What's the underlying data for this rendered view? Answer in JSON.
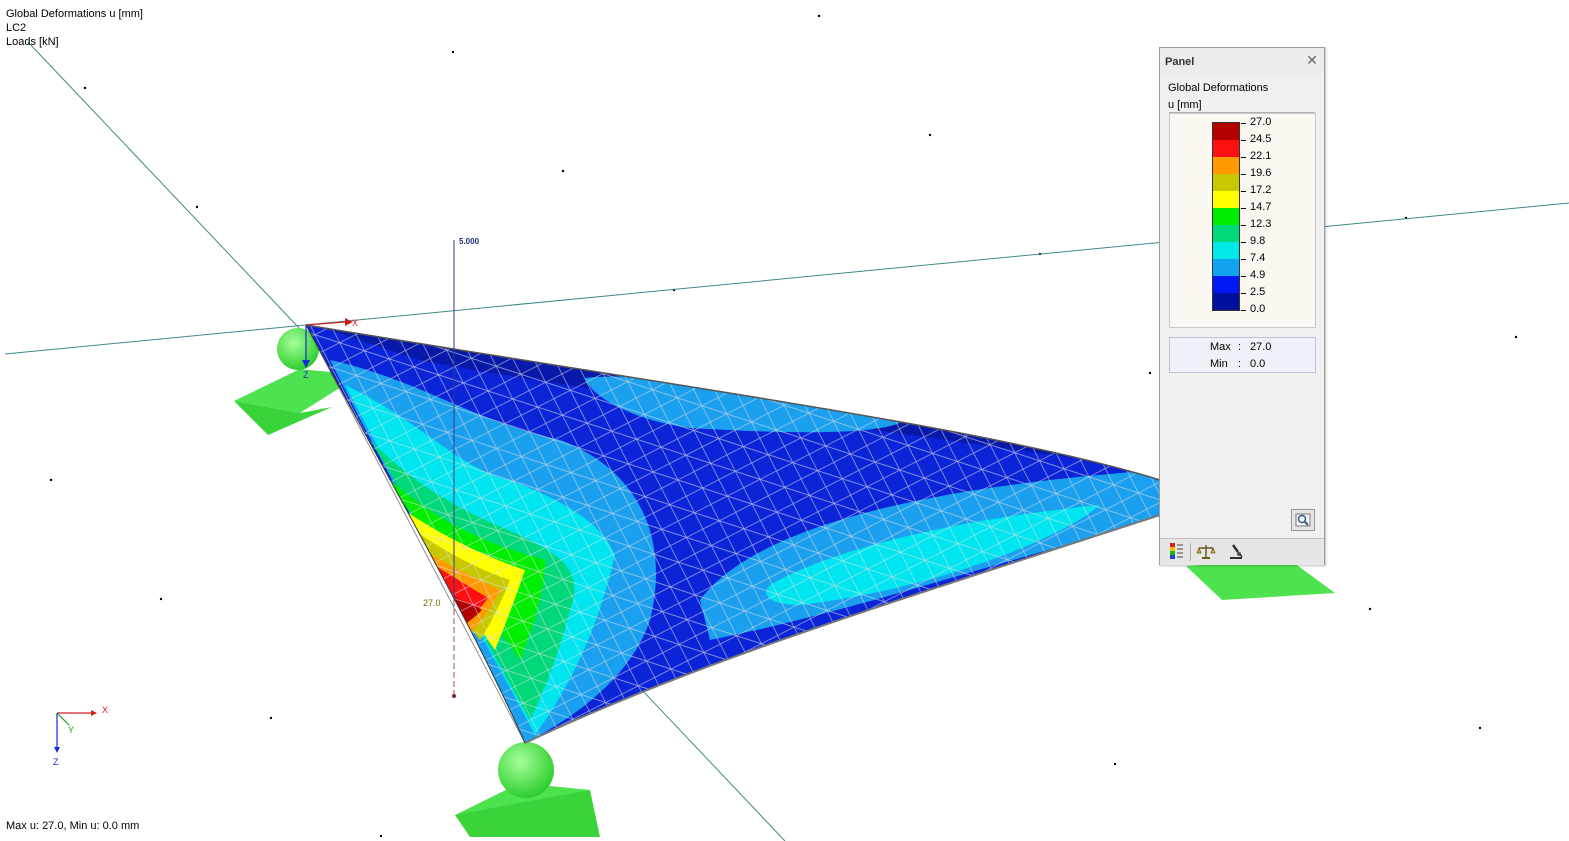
{
  "view": {
    "info_lines": [
      "Global Deformations u [mm]",
      "LC2",
      "Loads [kN]"
    ],
    "load_label": "5.000",
    "max_marker_label": "27.0",
    "status": "Max u: 27.0, Min u: 0.0 mm",
    "local_axis_labels": {
      "x": "X",
      "z": "Z"
    },
    "global_axis_labels": {
      "x": "X",
      "y": "Y",
      "z": "Z"
    }
  },
  "panel": {
    "title": "Panel",
    "close_icon": "close-icon",
    "result_name": "Global Deformations",
    "result_unit": "u [mm]",
    "legend": [
      {
        "value": "27.0",
        "color": "#b50000"
      },
      {
        "value": "24.5",
        "color": "#ff1010"
      },
      {
        "value": "22.1",
        "color": "#ff9a00"
      },
      {
        "value": "19.6",
        "color": "#c8c800"
      },
      {
        "value": "17.2",
        "color": "#ffff00"
      },
      {
        "value": "14.7",
        "color": "#00ee00"
      },
      {
        "value": "12.3",
        "color": "#00d87a"
      },
      {
        "value": "9.8",
        "color": "#00e8e8"
      },
      {
        "value": "7.4",
        "color": "#12a4ee"
      },
      {
        "value": "4.9",
        "color": "#0018f4"
      },
      {
        "value": "2.5",
        "color": "#00109e"
      },
      {
        "value": "0.0",
        "color": "#00109e"
      }
    ],
    "stats": {
      "max_label": "Max",
      "max_value": "27.0",
      "min_label": "Min",
      "min_value": "0.0"
    },
    "toolbar_icons": [
      "color-scale-icon",
      "balance-icon",
      "microscope-icon"
    ],
    "zoom_icon": "magnifier-icon"
  }
}
